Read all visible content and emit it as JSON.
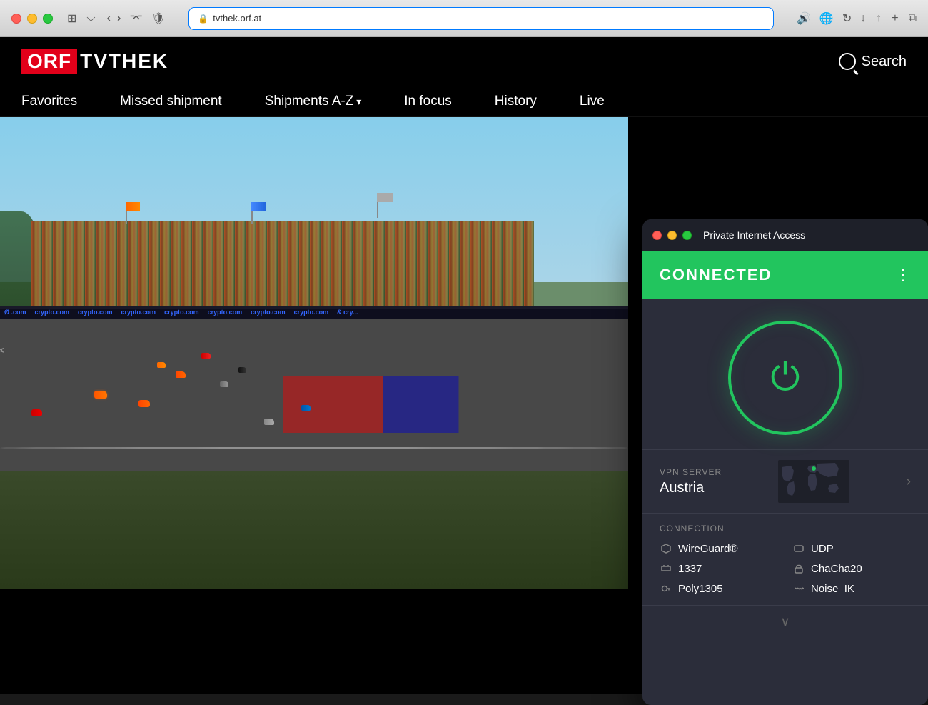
{
  "titlebar": {
    "url": "tvthek.orf.at",
    "tab_label": "tvthek.orf.at"
  },
  "orf": {
    "logo_orf": "ORF",
    "logo_tvthek": "TVTHEK",
    "search_label": "Search",
    "nav": [
      {
        "label": "Favorites",
        "dropdown": false
      },
      {
        "label": "Missed shipment",
        "dropdown": false
      },
      {
        "label": "Shipments A-Z",
        "dropdown": true
      },
      {
        "label": "In focus",
        "dropdown": false
      },
      {
        "label": "History",
        "dropdown": false
      },
      {
        "label": "Live",
        "dropdown": false
      }
    ]
  },
  "pia": {
    "title": "Private Internet Access",
    "connected_label": "CONNECTED",
    "menu_dots": "⋮",
    "server_section_label": "VPN SERVER",
    "server_name": "Austria",
    "connection_section_label": "CONNECTION",
    "connection_items": [
      {
        "icon": "wireguard-icon",
        "value": "WireGuard®"
      },
      {
        "icon": "udp-icon",
        "value": "UDP"
      },
      {
        "icon": "port-icon",
        "value": "1337"
      },
      {
        "icon": "lock-icon",
        "value": "ChaCha20"
      },
      {
        "icon": "key-icon",
        "value": "Poly1305"
      },
      {
        "icon": "noise-icon",
        "value": "Noise_IK"
      }
    ],
    "chevron_down": "∨"
  },
  "colors": {
    "connected_green": "#22c55e",
    "pia_bg": "#2b2d3a",
    "pia_dark": "#1e2029"
  }
}
